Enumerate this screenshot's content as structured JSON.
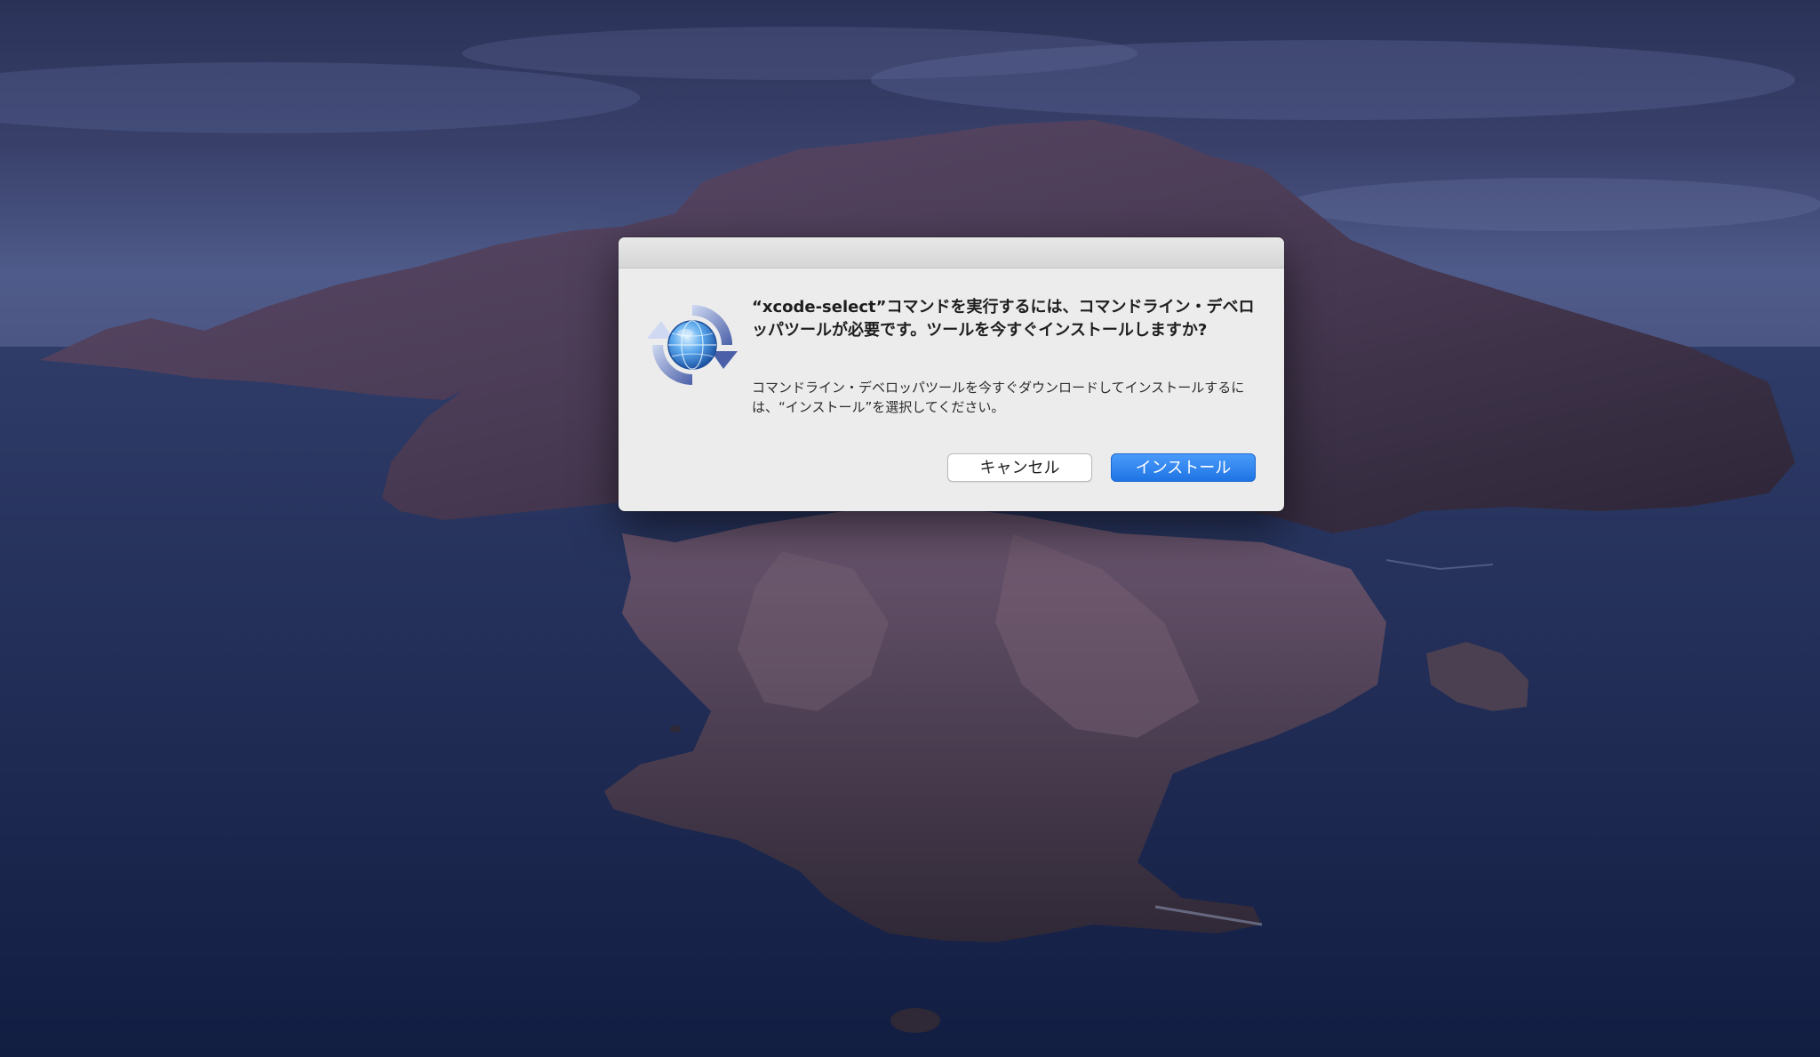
{
  "dialog": {
    "icon": "software-update-globe-icon",
    "title": "“xcode-select”コマンドを実行するには、コマンドライン・デベロッパツールが必要です。ツールを今すぐインストールしますか?",
    "body": "コマンドライン・デベロッパツールを今すぐダウンロードしてインストールするには、“インストール”を選択してください。",
    "cancel_label": "キャンセル",
    "install_label": "インストール"
  },
  "colors": {
    "dialog_background": "#ececec",
    "accent": "#1f74e4",
    "title_text": "#1e1e1e"
  }
}
